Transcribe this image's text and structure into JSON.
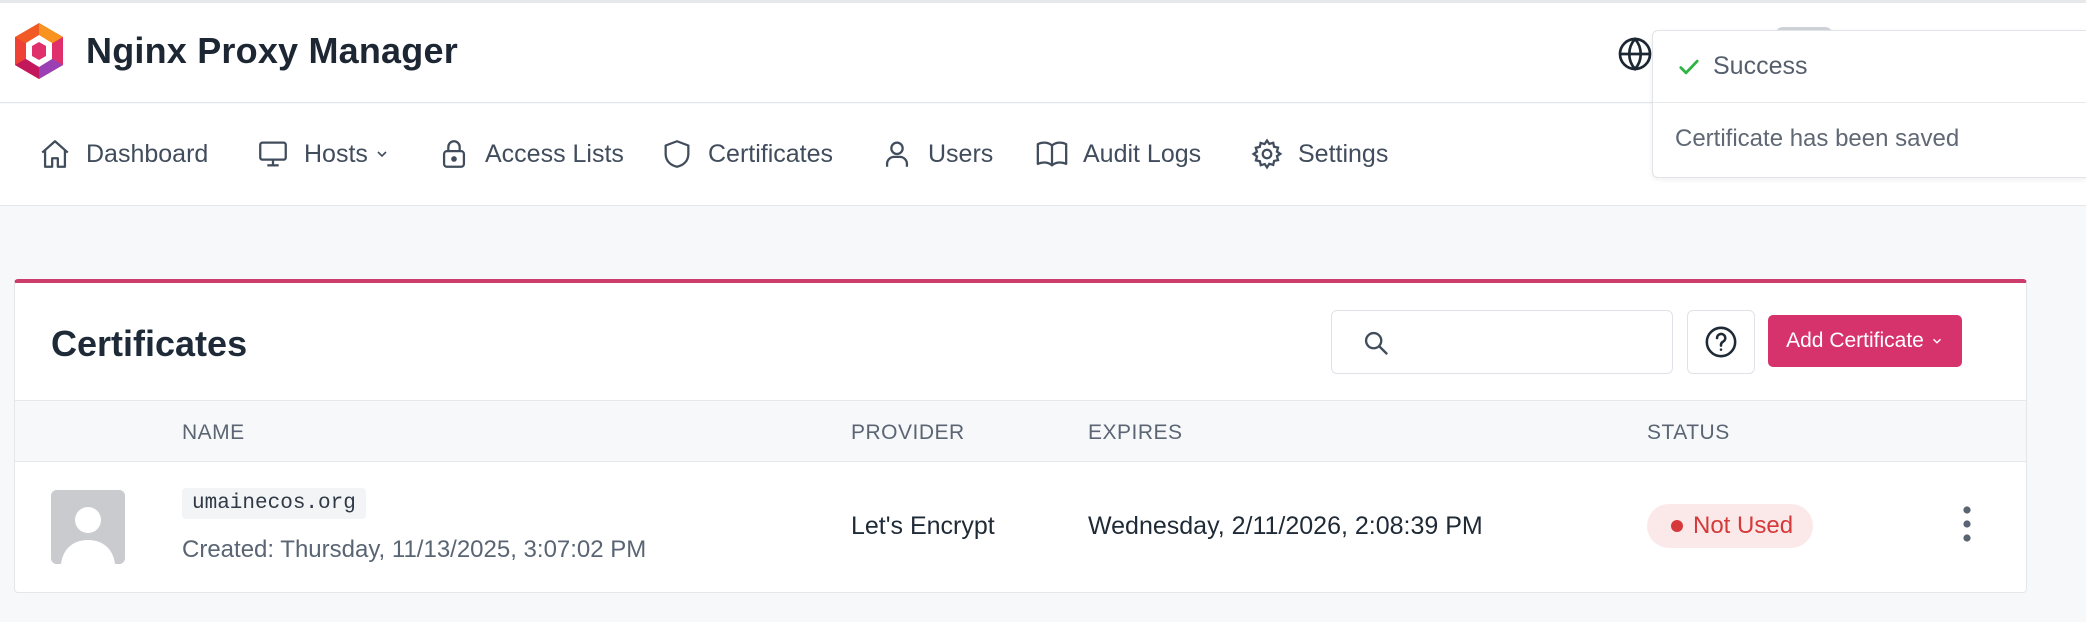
{
  "app": {
    "title": "Nginx Proxy Manager"
  },
  "nav": {
    "items": [
      {
        "label": "Dashboard",
        "icon": "home-icon"
      },
      {
        "label": "Hosts",
        "icon": "monitor-icon"
      },
      {
        "label": "Access Lists",
        "icon": "lock-icon"
      },
      {
        "label": "Certificates",
        "icon": "shield-icon"
      },
      {
        "label": "Users",
        "icon": "user-icon"
      },
      {
        "label": "Audit Logs",
        "icon": "book-icon"
      },
      {
        "label": "Settings",
        "icon": "gear-icon"
      }
    ]
  },
  "toast": {
    "title": "Success",
    "message": "Certificate has been saved"
  },
  "page": {
    "title": "Certificates",
    "search": {
      "value": "",
      "placeholder": ""
    },
    "add_button": "Add Certificate"
  },
  "table": {
    "columns": [
      "",
      "NAME",
      "PROVIDER",
      "EXPIRES",
      "STATUS"
    ],
    "rows": [
      {
        "name": "umainecos.org",
        "created": "Created: Thursday, 11/13/2025, 3:07:02 PM",
        "provider": "Let's Encrypt",
        "expires": "Wednesday, 2/11/2026, 2:08:39 PM",
        "status": "Not Used"
      }
    ]
  },
  "colors": {
    "accent": "#d6336c",
    "card_border_top": "#cc3d6b",
    "success": "#2fb344",
    "danger": "#d63939"
  }
}
